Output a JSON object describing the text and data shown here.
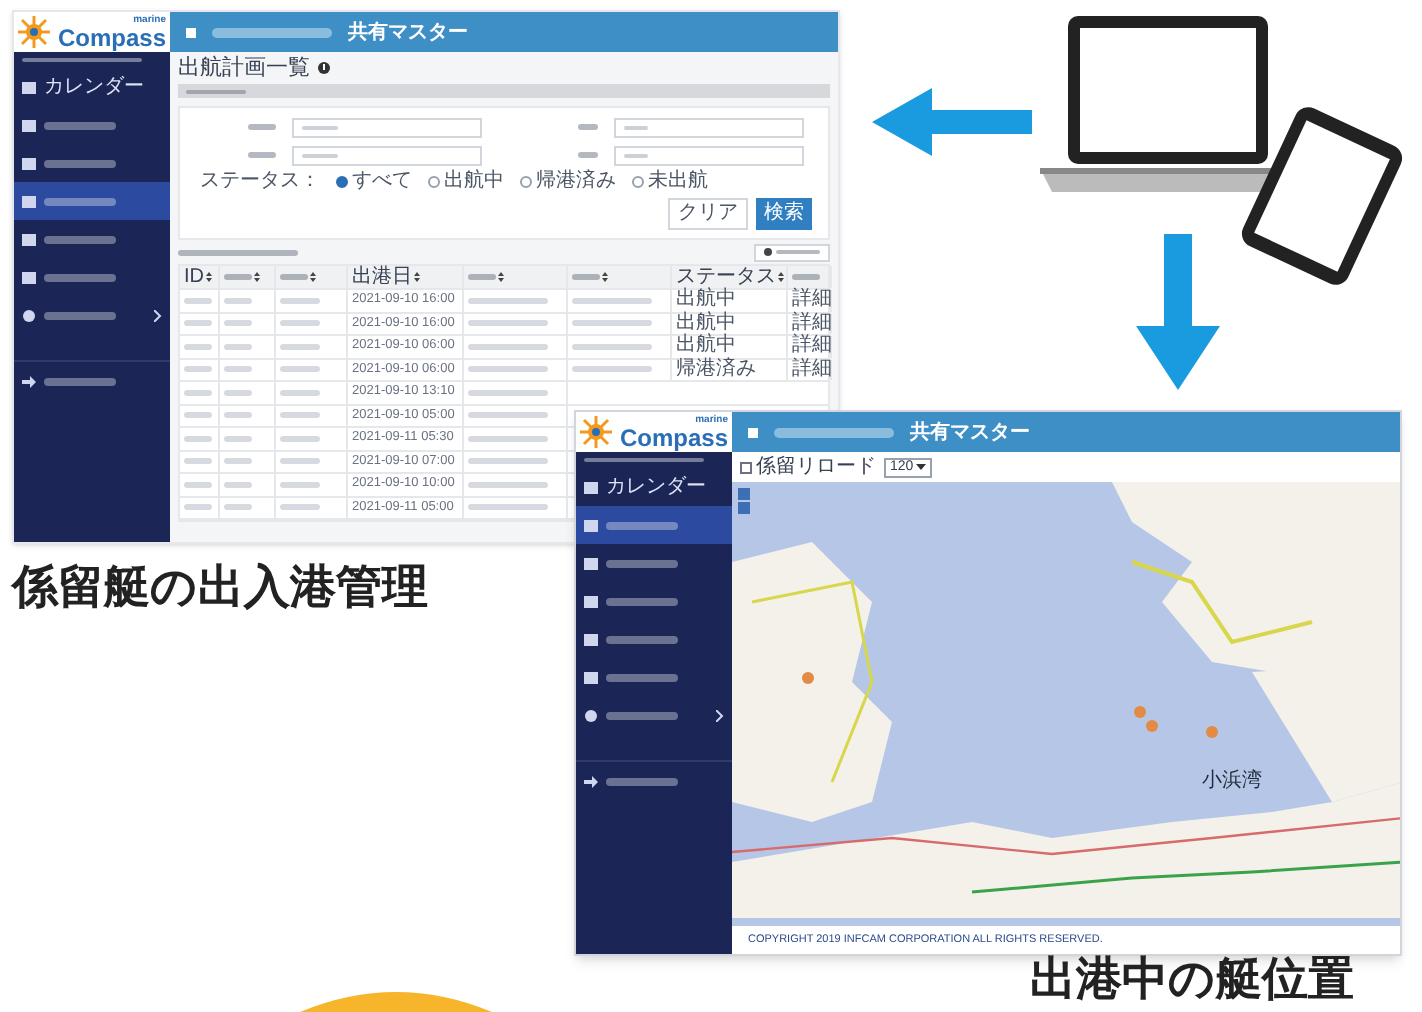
{
  "list_screen": {
    "logo": {
      "tagline": "marine",
      "name": "Compass"
    },
    "header": {
      "title": "共有マスター"
    },
    "sidebar": {
      "items": [
        {
          "label": "カレンダー",
          "selected": false
        },
        {
          "selected": false
        },
        {
          "selected": false
        },
        {
          "selected": true
        },
        {
          "selected": false
        },
        {
          "selected": false
        },
        {
          "selected": false,
          "kind": "submenu"
        },
        {
          "selected": false,
          "kind": "logout"
        }
      ]
    },
    "page_title": "出航計画一覧",
    "filter": {
      "status_label": "ステータス：",
      "status_options": [
        {
          "label": "すべて",
          "selected": true
        },
        {
          "label": "出航中",
          "selected": false
        },
        {
          "label": "帰港済み",
          "selected": false
        },
        {
          "label": "未出航",
          "selected": false
        }
      ]
    },
    "buttons": [
      {
        "label": "クリア",
        "kind": "secondary"
      },
      {
        "label": "検索",
        "kind": "primary"
      }
    ],
    "table": {
      "columns": [
        {
          "label": "ID"
        },
        {},
        {},
        {
          "label": "出港日"
        },
        {},
        {},
        {
          "label": "ステータス"
        },
        {}
      ],
      "rows": [
        {
          "cells": [
            null,
            null,
            null,
            "2021-09-10 16:00",
            null,
            null,
            "出航中",
            "詳細"
          ]
        },
        {
          "cells": [
            null,
            null,
            null,
            "2021-09-10 16:00",
            null,
            null,
            "出航中",
            "詳細"
          ]
        },
        {
          "cells": [
            null,
            null,
            null,
            "2021-09-10 06:00",
            null,
            null,
            "出航中",
            "詳細"
          ]
        },
        {
          "cells": [
            null,
            null,
            null,
            "2021-09-10 06:00",
            null,
            null,
            "帰港済み",
            "詳細"
          ]
        },
        {
          "cells": [
            null,
            null,
            null,
            "2021-09-10 13:10",
            null
          ]
        },
        {
          "cells": [
            null,
            null,
            null,
            "2021-09-10 05:00",
            null
          ]
        },
        {
          "cells": [
            null,
            null,
            null,
            "2021-09-11 05:30",
            null
          ]
        },
        {
          "cells": [
            null,
            null,
            null,
            "2021-09-10 07:00",
            null
          ]
        },
        {
          "cells": [
            null,
            null,
            null,
            "2021-09-10 10:00",
            null
          ]
        },
        {
          "cells": [
            null,
            null,
            null,
            "2021-09-11 05:00",
            null
          ]
        }
      ]
    }
  },
  "map_screen": {
    "logo": {
      "tagline": "marine",
      "name": "Compass"
    },
    "header": {
      "title": "共有マスター"
    },
    "sidebar": {
      "items": [
        {
          "label": "カレンダー",
          "selected": false
        },
        {
          "selected": true
        },
        {
          "selected": false
        },
        {
          "selected": false
        },
        {
          "selected": false
        },
        {
          "selected": false
        },
        {
          "selected": false,
          "kind": "submenu"
        },
        {
          "selected": false,
          "kind": "logout"
        }
      ]
    },
    "toolbar": {
      "reload": {
        "label": "係留リロード",
        "checked": false
      },
      "interval": "120"
    },
    "map": {
      "labels": [
        "小浜湾"
      ]
    },
    "footer": "COPYRIGHT 2019 INFCAM CORPORATION ALL RIGHTS RESERVED."
  },
  "captions": [
    "係留艇の出入港管理",
    "出港中の艇位置"
  ]
}
